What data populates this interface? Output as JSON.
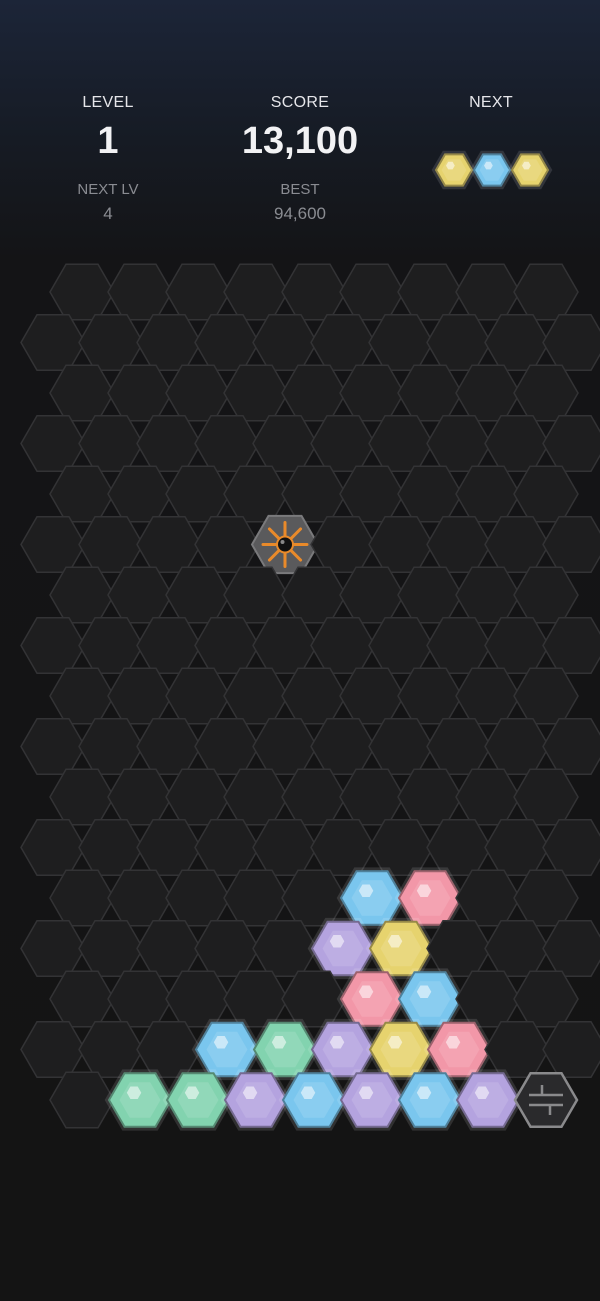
{
  "hud": {
    "level_label": "LEVEL",
    "level_value": "1",
    "next_lv_label": "NEXT LV",
    "next_lv_value": "4",
    "score_label": "SCORE",
    "score_value": "13,100",
    "best_label": "BEST",
    "best_value": "94,600",
    "next_label": "NEXT"
  },
  "colors": {
    "empty": "#1e1e1f",
    "empty_stroke": "#333335",
    "yellow": "#e6d36e",
    "blue": "#7ac6ee",
    "pink": "#f297a8",
    "purple": "#b4a3df",
    "green": "#82d3af",
    "bomb": "#5a5a5c",
    "blocker": "#2a2a2c"
  },
  "next_piece": [
    "yellow",
    "blue",
    "yellow"
  ],
  "board": {
    "rows": 17,
    "columns": 9,
    "bomb": {
      "row": 5,
      "col": 4,
      "icon": "bomb-icon"
    },
    "blocker": {
      "row": 16,
      "col": 8,
      "icon": "grate-icon"
    },
    "pieces": [
      {
        "row": 12,
        "col": 5,
        "color": "blue"
      },
      {
        "row": 12,
        "col": 6,
        "color": "pink"
      },
      {
        "row": 13,
        "col": 5,
        "color": "purple"
      },
      {
        "row": 13,
        "col": 6,
        "color": "yellow"
      },
      {
        "row": 14,
        "col": 5,
        "color": "pink"
      },
      {
        "row": 14,
        "col": 6,
        "color": "blue"
      },
      {
        "row": 15,
        "col": 3,
        "color": "blue"
      },
      {
        "row": 15,
        "col": 4,
        "color": "green"
      },
      {
        "row": 15,
        "col": 5,
        "color": "purple"
      },
      {
        "row": 15,
        "col": 6,
        "color": "yellow"
      },
      {
        "row": 15,
        "col": 7,
        "color": "pink"
      },
      {
        "row": 16,
        "col": 1,
        "color": "green"
      },
      {
        "row": 16,
        "col": 2,
        "color": "green"
      },
      {
        "row": 16,
        "col": 3,
        "color": "purple"
      },
      {
        "row": 16,
        "col": 4,
        "color": "blue"
      },
      {
        "row": 16,
        "col": 5,
        "color": "purple"
      },
      {
        "row": 16,
        "col": 6,
        "color": "blue"
      },
      {
        "row": 16,
        "col": 7,
        "color": "purple"
      }
    ]
  }
}
